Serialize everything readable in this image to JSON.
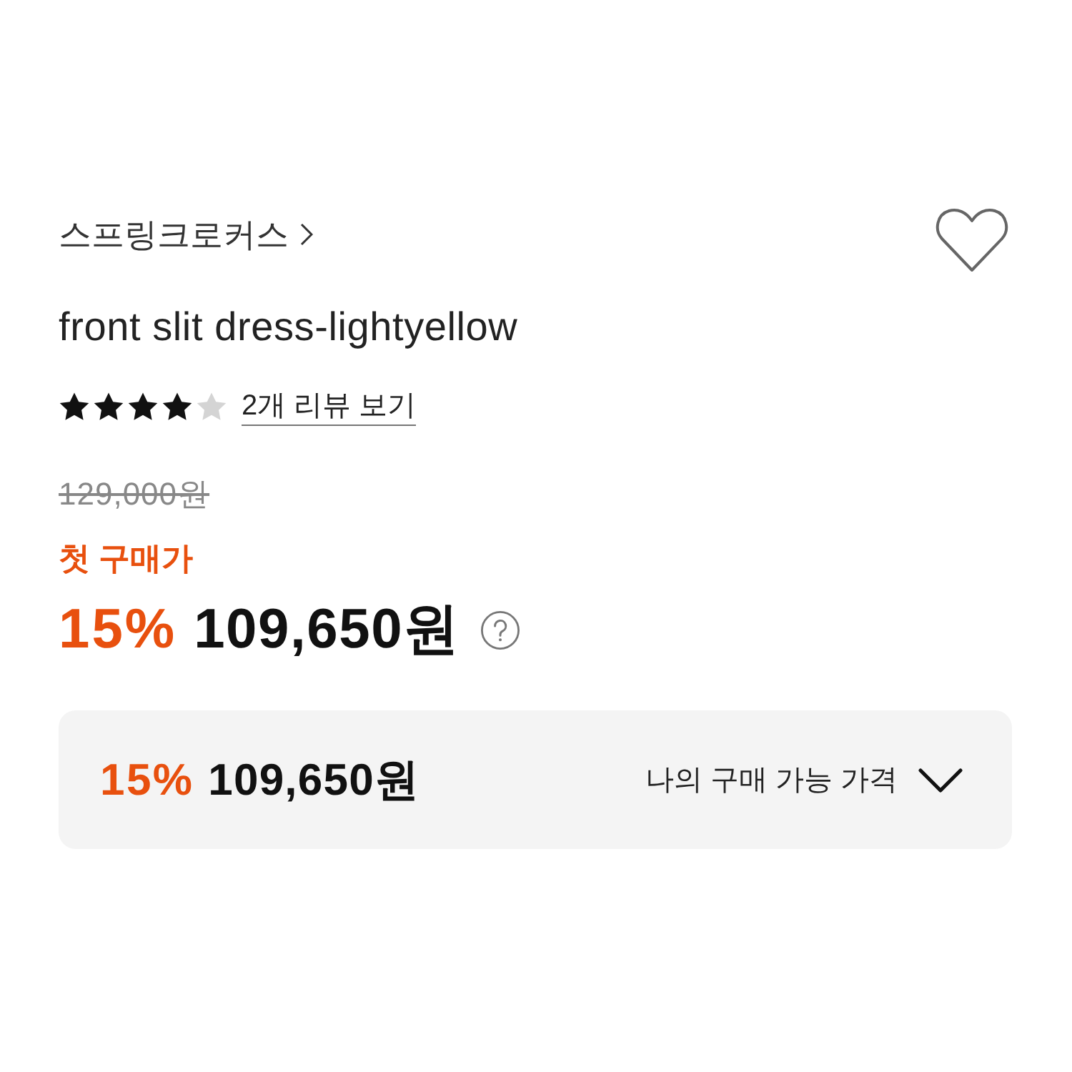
{
  "product": {
    "brand": "스프링크로커스",
    "title": "front slit dress-lightyellow",
    "wishlisted": false
  },
  "rating": {
    "stars": 4,
    "review_link": "2개 리뷰 보기"
  },
  "price": {
    "original": "129,000원",
    "promo_label": "첫 구매가",
    "discount": "15%",
    "final": "109,650원"
  },
  "my_price": {
    "discount": "15%",
    "final": "109,650원",
    "label": "나의 구매 가능 가격",
    "expanded": false
  }
}
